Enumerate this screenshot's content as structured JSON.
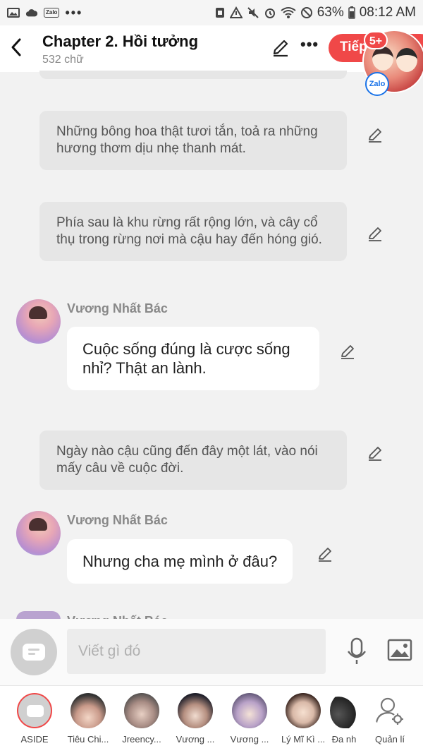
{
  "status_bar": {
    "battery": "63%",
    "time": "08:12 AM",
    "zalo_mini": "Zalo",
    "more": "•••"
  },
  "header": {
    "title": "Chapter 2. Hồi tưởng",
    "subtitle": "532 chữ",
    "next_label": "Tiếp",
    "more": "•••"
  },
  "chat_head": {
    "badge": "5+",
    "app_label": "Zalo"
  },
  "conversation": {
    "narration_1": "Những bông hoa thật tươi tắn, toả ra những hương thơm dịu nhẹ thanh mát.",
    "narration_2": "Phía sau là khu rừng rất rộng lớn, và cây cổ thụ trong rừng nơi mà cậu hay đến hóng gió.",
    "message_1": {
      "speaker": "Vương Nhất Bác",
      "text": "Cuộc sống đúng là cược sống nhỉ? Thật an lành."
    },
    "narration_3": "Ngày nào cậu cũng đến đây một lát, vào nói mấy câu về cuộc đời.",
    "message_2": {
      "speaker": "Vương Nhất Bác",
      "text": "Nhưng cha mẹ mình ở đâu?"
    },
    "peek_speaker": "Vương Nhất Bác"
  },
  "composer": {
    "placeholder": "Viết gì đó"
  },
  "tray": {
    "items": [
      {
        "label": "ASIDE"
      },
      {
        "label": "Tiêu Chi..."
      },
      {
        "label": "Jreency..."
      },
      {
        "label": "Vương ..."
      },
      {
        "label": "Vương ..."
      },
      {
        "label": "Lý Mĩ Kì ..."
      },
      {
        "label": "Đa nh"
      },
      {
        "label": "Quản lí"
      }
    ]
  },
  "colors": {
    "accent": "#f04848",
    "narration_bg": "#e6e6e6",
    "message_bg": "#ffffff",
    "page_bg": "#f2f2f2"
  }
}
